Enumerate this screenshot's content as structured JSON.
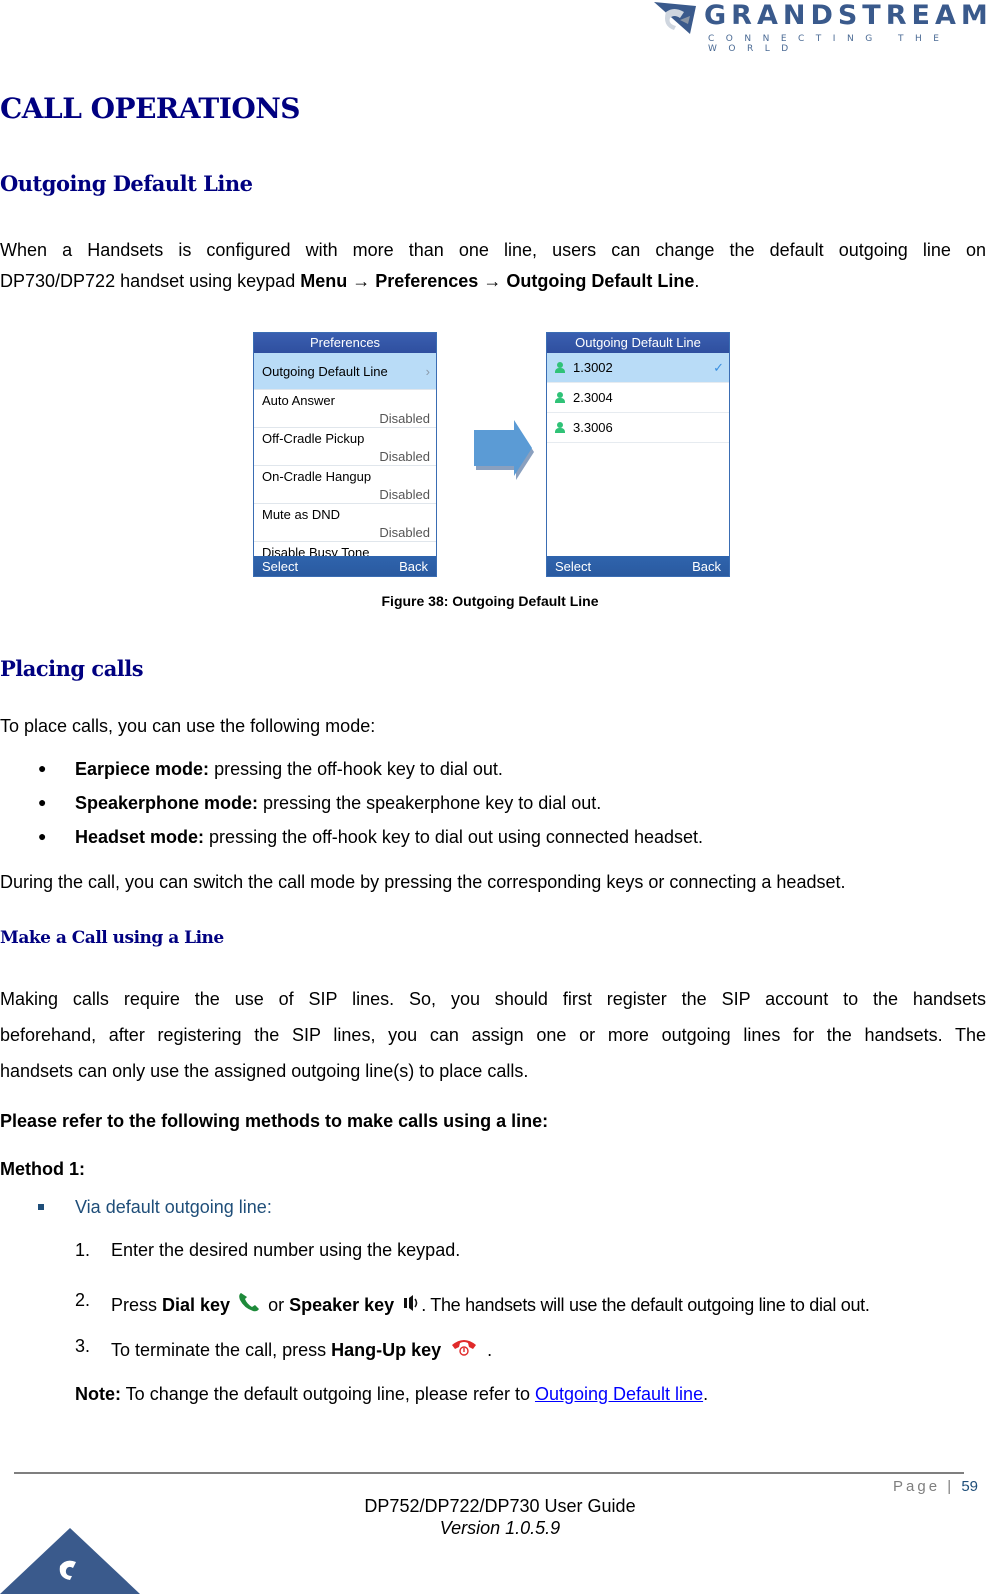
{
  "brand": {
    "name": "GRANDSTREAM",
    "tagline": "CONNECTING THE WORLD",
    "colors": {
      "heading": "#000080",
      "logo": "#3a5a8c",
      "link": "#0000ff",
      "screen_header": "#2f4f9f",
      "selected_row": "#b9dcf7"
    }
  },
  "section": {
    "title": "CALL OPERATIONS",
    "outgoing_default_line": {
      "heading": "Outgoing Default Line",
      "para_line1": "When a Handsets is configured with more than one line, users can change the default outgoing line on",
      "para_line2_prefix": "DP730/DP722 handset using keypad ",
      "menu": "Menu",
      "arrow": "→",
      "preferences": "Preferences",
      "arrow_bold": "→",
      "target": "Outgoing Default Line",
      "para_end": "."
    },
    "figure": {
      "caption": "Figure 38: Outgoing Default Line",
      "screen1": {
        "title": "Preferences",
        "selected": "Outgoing Default Line",
        "items": [
          {
            "label": "Auto Answer",
            "value": "Disabled"
          },
          {
            "label": "Off-Cradle Pickup",
            "value": "Disabled"
          },
          {
            "label": "On-Cradle Hangup",
            "value": "Disabled"
          },
          {
            "label": "Mute as DND",
            "value": "Disabled"
          },
          {
            "label": "Disable Busy Tone",
            "value": ""
          }
        ],
        "softkey_left": "Select",
        "softkey_right": "Back"
      },
      "screen2": {
        "title": "Outgoing Default Line",
        "lines": [
          "1.3002",
          "2.3004",
          "3.3006"
        ],
        "selected_index": 0,
        "softkey_left": "Select",
        "softkey_right": "Back"
      }
    },
    "placing_calls": {
      "heading": "Placing calls",
      "intro": "To place calls, you can use the following mode:",
      "modes": [
        {
          "label": "Earpiece mode:",
          "text": " pressing the off-hook key to dial out."
        },
        {
          "label": "Speakerphone mode:",
          "text": " pressing the speakerphone key to dial out."
        },
        {
          "label": "Headset mode:",
          "text": " pressing the off-hook key to dial out using connected headset."
        }
      ],
      "outro": "During the call, you can switch the call mode by pressing the corresponding keys or connecting a headset."
    },
    "make_call": {
      "heading": "Make a Call using a Line",
      "para_lines": [
        "Making calls require the use of SIP lines. So, you should first register the SIP account to the handsets",
        "beforehand, after registering the SIP lines, you can assign one or more outgoing lines for the handsets. The",
        "handsets can only use the assigned outgoing line(s) to place calls."
      ],
      "methods_intro": "Please refer to the following methods to make calls using a line:",
      "method1_label": "Method 1:",
      "method1_sub": "Via default outgoing line:",
      "steps": {
        "s1_num": "1.",
        "s1_text": "Enter the desired number using the keypad.",
        "s2_num": "2.",
        "s2_pre": "Press ",
        "s2_dial": "Dial key",
        "s2_or": " or ",
        "s2_speaker": "Speaker key",
        "s2_post": ". The handsets will use the default outgoing line to dial out.",
        "s3_num": "3.",
        "s3_pre": "To terminate the call, press ",
        "s3_key": "Hang-Up key",
        "s3_post": " ."
      },
      "note_label": "Note:",
      "note_text": " To change the default outgoing line, please refer to ",
      "note_link": "Outgoing Default line",
      "note_end": "."
    }
  },
  "footer": {
    "page_label": "Page |",
    "page_number": "59",
    "guide_title": "DP752/DP722/DP730 User Guide",
    "version": "Version 1.0.5.9"
  }
}
